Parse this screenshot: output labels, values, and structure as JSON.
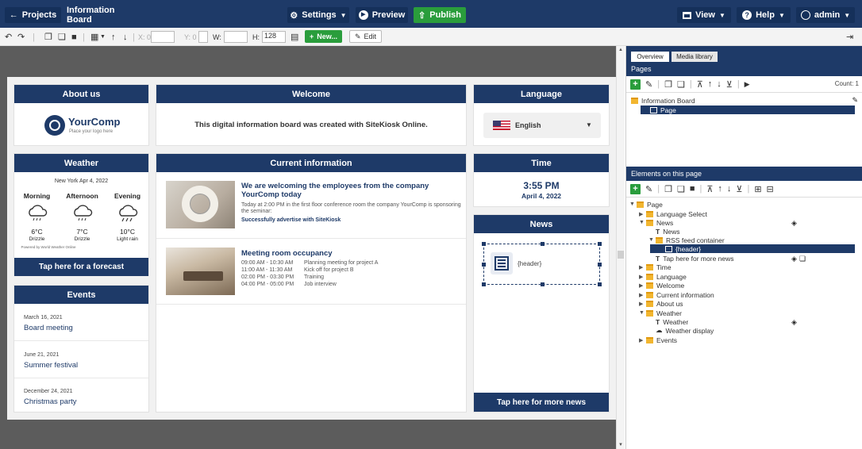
{
  "topbar": {
    "projects_label": "Projects",
    "title": "Information Board",
    "settings_label": "Settings",
    "preview_label": "Preview",
    "publish_label": "Publish",
    "view_label": "View",
    "help_label": "Help",
    "user_label": "admin"
  },
  "toolbar": {
    "x_label": "X: 0",
    "y_label": "Y: 0",
    "w_label": "W:",
    "h_label": "H:",
    "h_value": "128",
    "new_label": "New...",
    "edit_label": "Edit"
  },
  "board": {
    "about": {
      "title": "About us",
      "logo_name": "YourComp",
      "logo_tagline": "Place your logo here"
    },
    "welcome": {
      "title": "Welcome",
      "text": "This digital information board was created with SiteKiosk Online."
    },
    "language": {
      "title": "Language",
      "selected": "English"
    },
    "weather": {
      "title": "Weather",
      "date_line": "New York Apr 4, 2022",
      "periods": [
        {
          "name": "Morning",
          "temp": "6°C",
          "desc": "Drizzle"
        },
        {
          "name": "Afternoon",
          "temp": "7°C",
          "desc": "Drizzle"
        },
        {
          "name": "Evening",
          "temp": "10°C",
          "desc": "Light rain"
        }
      ],
      "powered": "Powered by World Weather Online",
      "forecast_button": "Tap here for a forecast"
    },
    "current": {
      "title": "Current information",
      "items": [
        {
          "heading": "We are welcoming the employees from the company YourComp today",
          "body": "Today at 2:00 PM in the first floor conference room the company YourComp is sponsoring the seminar:",
          "emphasis": "Successfully advertise with SiteKiosk"
        },
        {
          "heading": "Meeting room occupancy",
          "schedule": [
            {
              "time": "09:00 AM - 10:30 AM",
              "event": "Planning meeting for project A"
            },
            {
              "time": "11:00 AM - 11:30 AM",
              "event": "Kick off for project B"
            },
            {
              "time": "02:00 PM - 03:30 PM",
              "event": "Training"
            },
            {
              "time": "04:00 PM - 05:00 PM",
              "event": "Job interview"
            }
          ]
        }
      ]
    },
    "time": {
      "title": "Time",
      "clock": "3:55 PM",
      "date": "April 4, 2022"
    },
    "news": {
      "title": "News",
      "header_placeholder": "{header}",
      "more_button": "Tap here for more news"
    },
    "events": {
      "title": "Events",
      "items": [
        {
          "date": "March 16, 2021",
          "name": "Board meeting"
        },
        {
          "date": "June 21, 2021",
          "name": "Summer festival"
        },
        {
          "date": "December 24, 2021",
          "name": "Christmas party"
        }
      ]
    }
  },
  "panel": {
    "tabs": [
      "Overview",
      "Media library"
    ],
    "pages_header": "Pages",
    "count_label": "Count: 1",
    "pages_tree": [
      "Information Board",
      "Page"
    ],
    "elements_header": "Elements on this page",
    "elements_tree": [
      "Page",
      "Language Select",
      "News",
      "News",
      "RSS feed container",
      "{header}",
      "Tap here for more news",
      "Time",
      "Language",
      "Welcome",
      "Current information",
      "About us",
      "Weather",
      "Weather",
      "Weather display",
      "Events"
    ]
  },
  "colors": {
    "brand_navy": "#1e3a68",
    "publish_green": "#2a9d3c",
    "canvas_gray": "#5c5c5c"
  }
}
